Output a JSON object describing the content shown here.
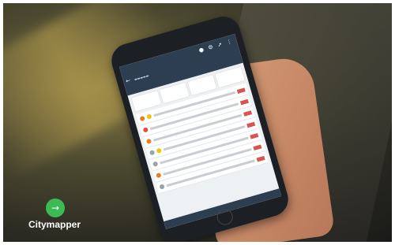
{
  "brand": {
    "name": "Citymapper",
    "logo_icon": "arrow-right-icon",
    "logo_color": "#3cba54"
  },
  "phone_app": {
    "header_color": "#2c3e50",
    "header_icons": [
      "walk-icon",
      "gear-icon",
      "share-icon",
      "more-icon"
    ],
    "visible_rows": 7
  }
}
